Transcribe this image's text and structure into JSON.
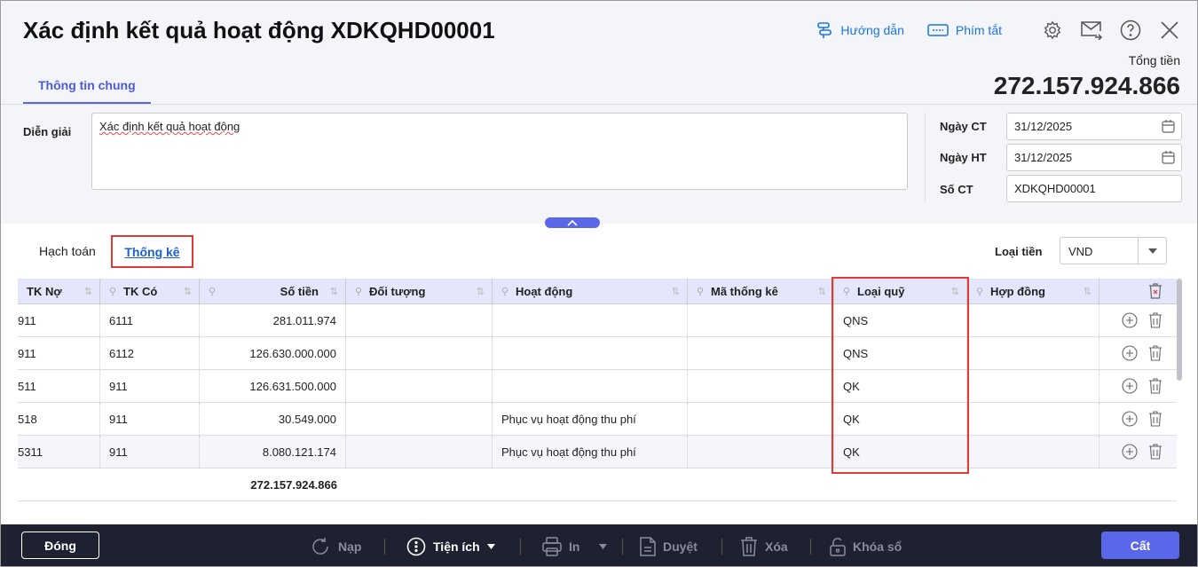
{
  "header": {
    "title": "Xác định kết quả hoạt động XDKQHD00001",
    "guide": "Hướng dẫn",
    "shortcuts": "Phím tắt",
    "total_label": "Tổng tiền",
    "total_value": "272.157.924.866"
  },
  "tabs": [
    {
      "label": "Thông tin chung"
    }
  ],
  "form": {
    "desc_label": "Diễn giải",
    "desc_value": "Xác định kết quả hoạt động",
    "ngay_ct_label": "Ngày CT",
    "ngay_ct": "31/12/2025",
    "ngay_ht_label": "Ngày HT",
    "ngay_ht": "31/12/2025",
    "so_ct_label": "Số CT",
    "so_ct": "XDKQHD00001"
  },
  "subtabs": {
    "hach_toan": "Hạch toán",
    "thong_ke": "Thống kê"
  },
  "currency": {
    "label": "Loại tiền",
    "value": "VND"
  },
  "table": {
    "columns": [
      "TK Nợ",
      "TK Có",
      "Số tiền",
      "Đối tượng",
      "Hoạt động",
      "Mã thống kê",
      "Loại quỹ",
      "Hợp đồng"
    ],
    "rows": [
      [
        "911",
        "6111",
        "281.011.974",
        "",
        "",
        "",
        "QNS",
        ""
      ],
      [
        "911",
        "6112",
        "126.630.000.000",
        "",
        "",
        "",
        "QNS",
        ""
      ],
      [
        "511",
        "911",
        "126.631.500.000",
        "",
        "",
        "",
        "QK",
        ""
      ],
      [
        "518",
        "911",
        "30.549.000",
        "",
        "Phục vụ hoạt động thu phí",
        "",
        "QK",
        ""
      ],
      [
        "5311",
        "911",
        "8.080.121.174",
        "",
        "Phục vụ hoạt động thu phí",
        "",
        "QK",
        ""
      ]
    ],
    "total": "272.157.924.866"
  },
  "footer": {
    "close": "Đóng",
    "reload": "Nạp",
    "utilities": "Tiện ích",
    "print": "In",
    "approve": "Duyệt",
    "delete": "Xóa",
    "lock": "Khóa sổ",
    "save": "Cất"
  },
  "colors": {
    "accent": "#5a67e8",
    "highlight": "#e53935",
    "link": "#1a73e8"
  }
}
